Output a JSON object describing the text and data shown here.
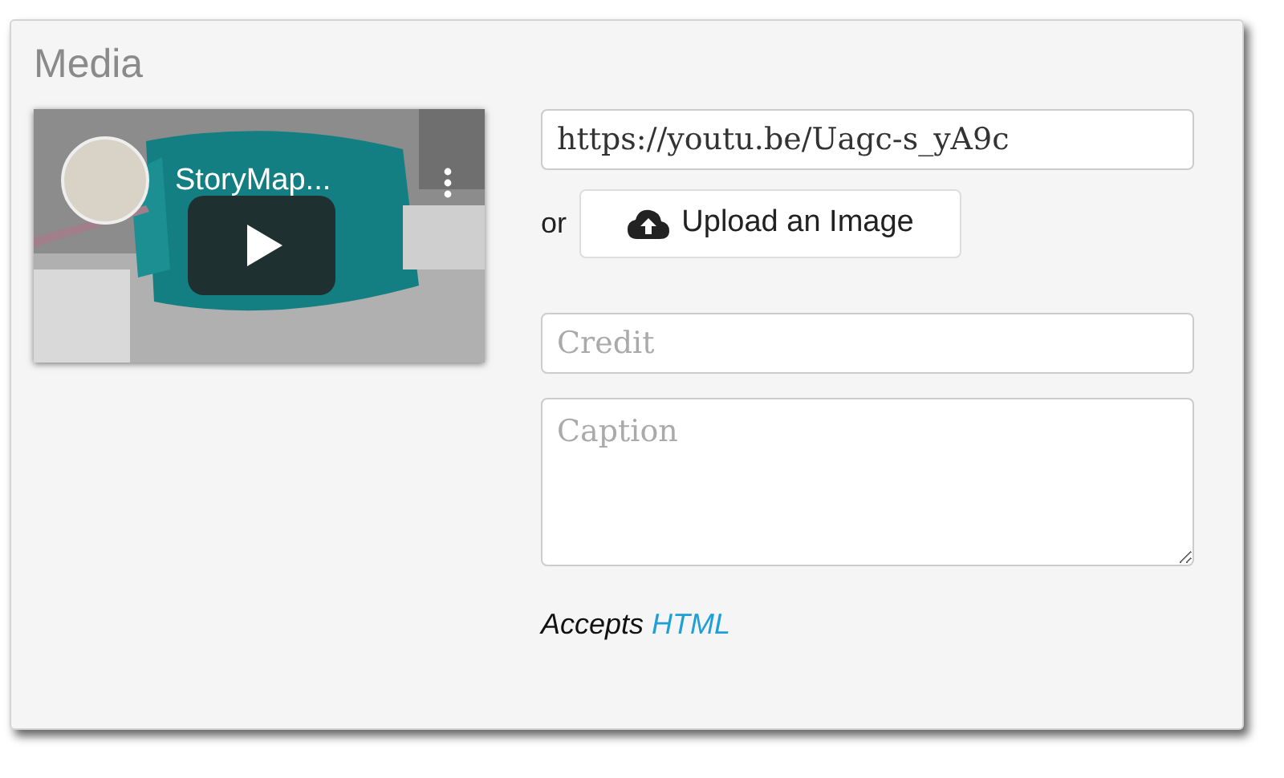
{
  "panel": {
    "title": "Media"
  },
  "video": {
    "kind": "picture",
    "title": "StoryMap..."
  },
  "url_field": {
    "value": "https://youtu.be/Uagc-s_yA9c"
  },
  "upload": {
    "prefix": "or",
    "label": "Upload an Image"
  },
  "credit_field": {
    "placeholder": "Credit"
  },
  "caption_field": {
    "placeholder": "Caption"
  },
  "note": {
    "text": "Accepts",
    "link": "HTML"
  }
}
